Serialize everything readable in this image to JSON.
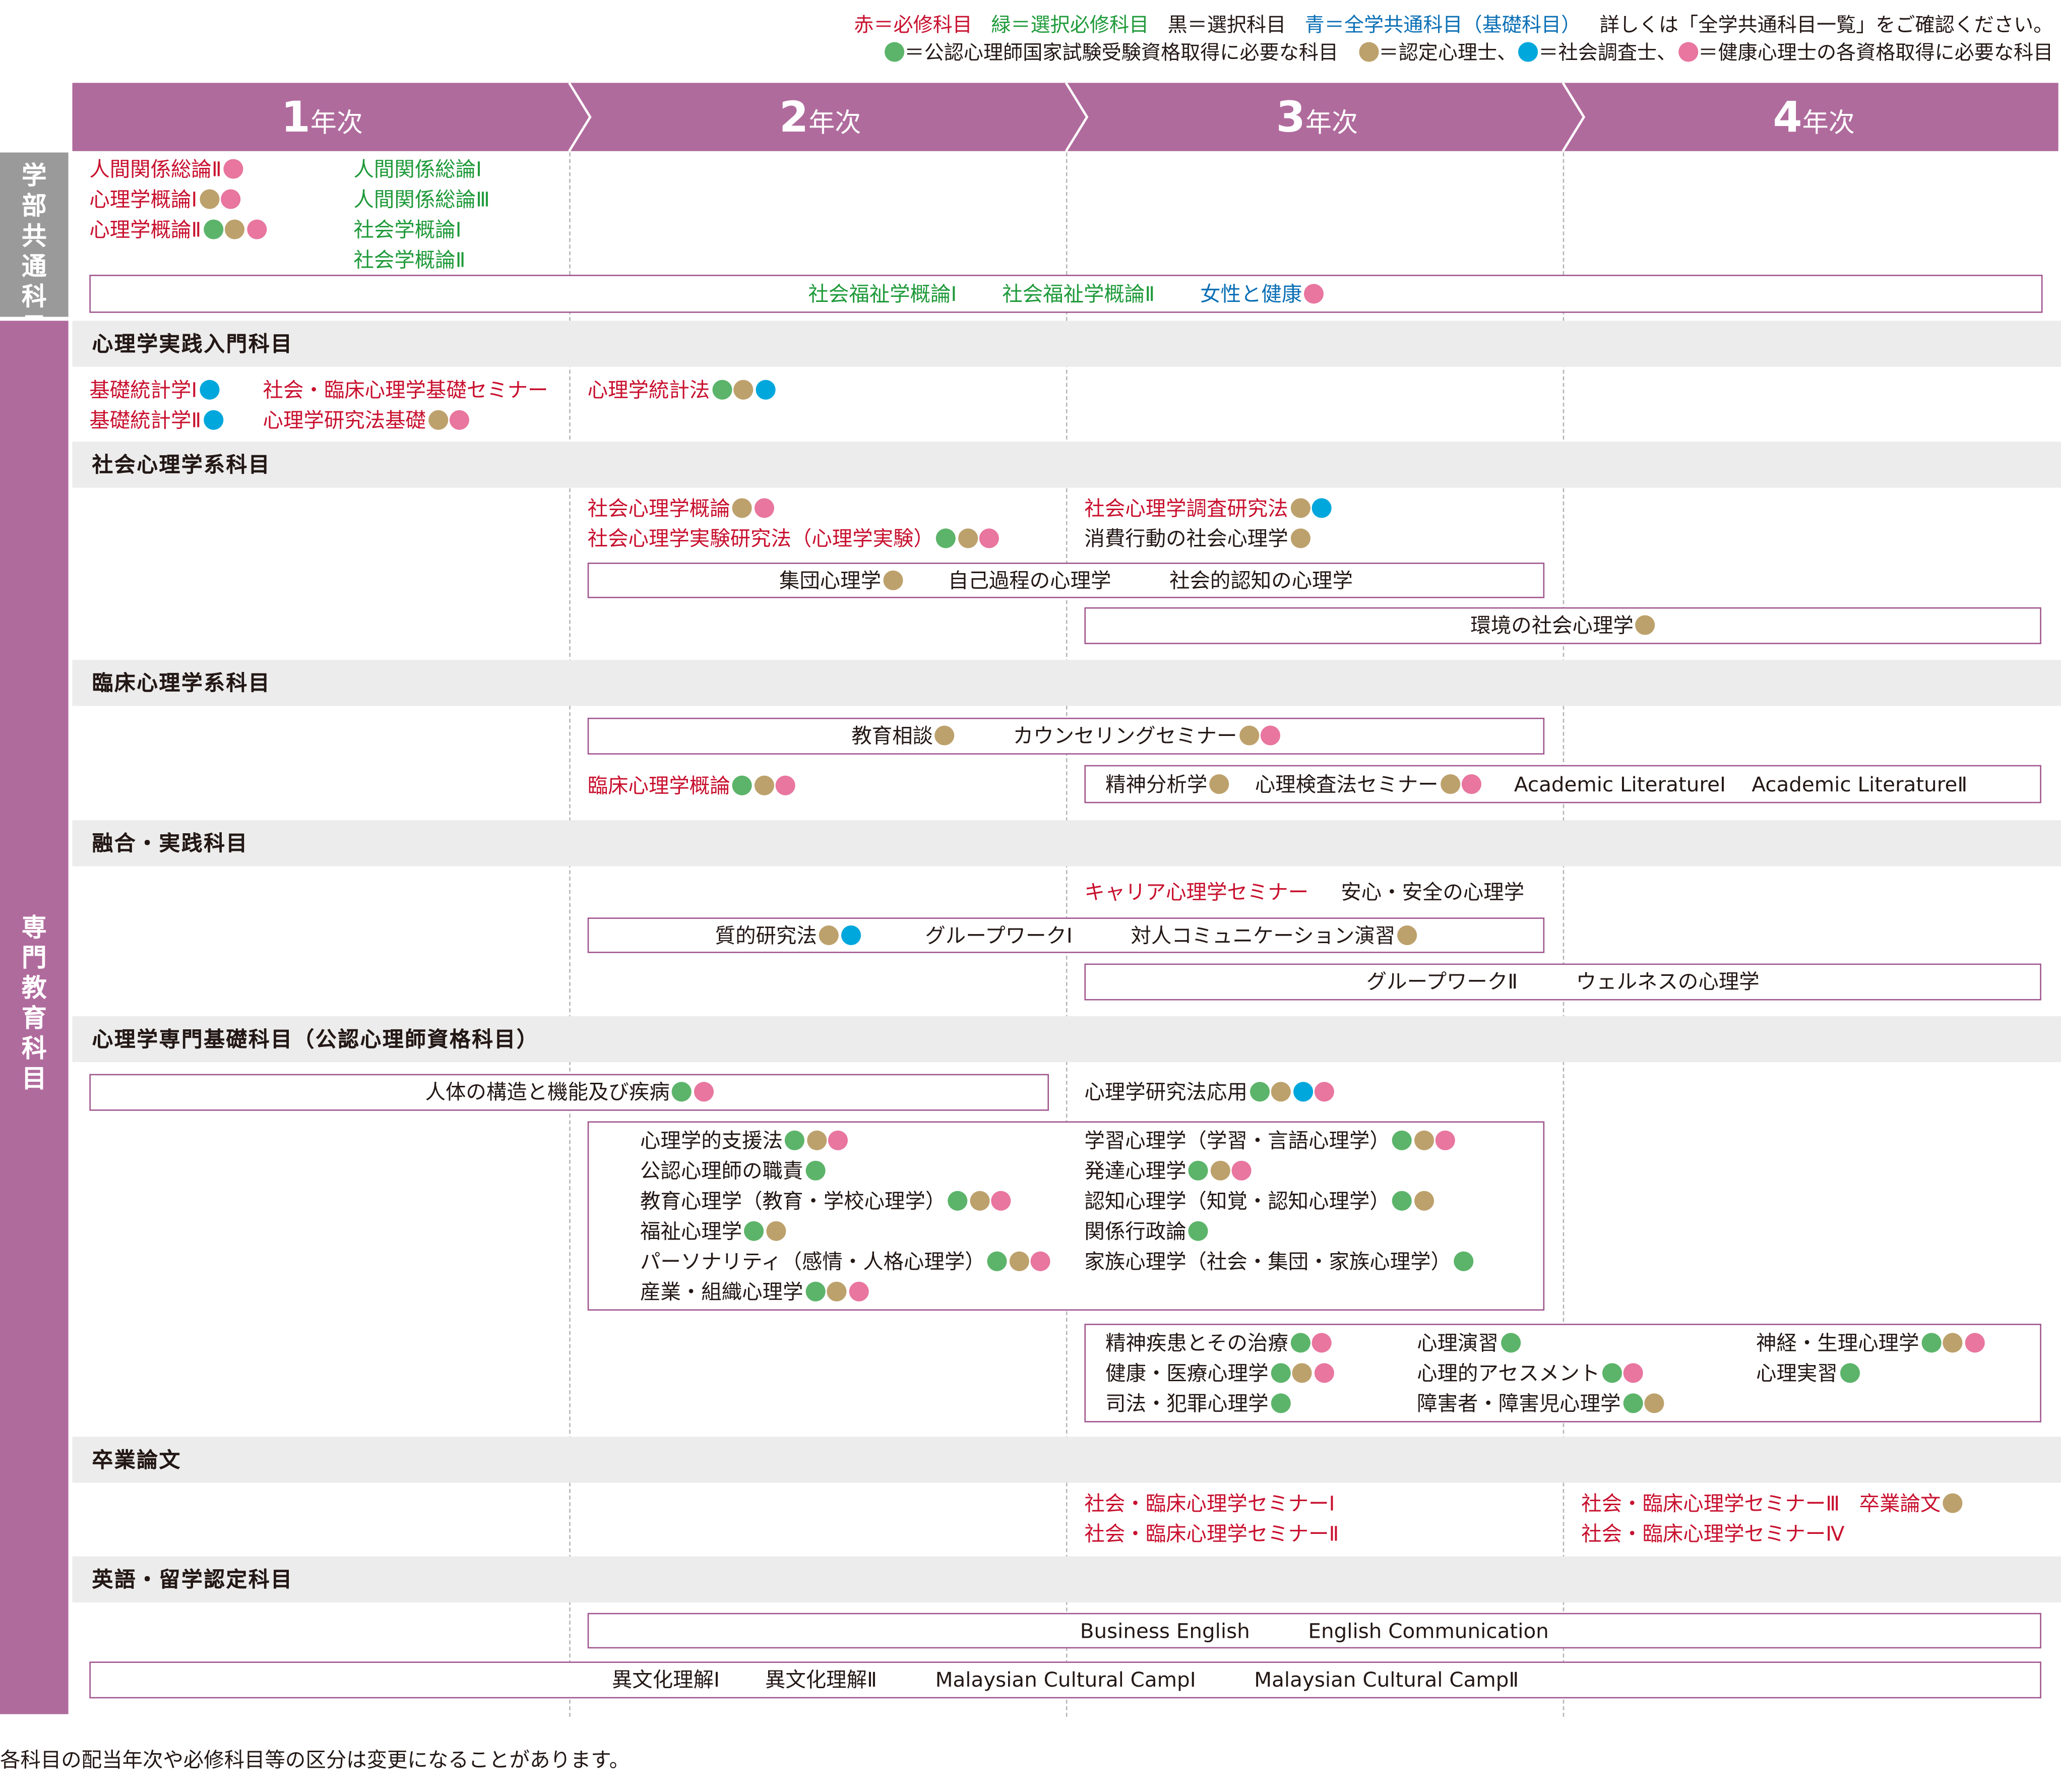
{
  "colors": {
    "purple": "#b06b9d",
    "red": "#c8102e",
    "green": "#1f9a3a",
    "blue": "#0a6fb5",
    "gray": "#9a9a9a",
    "dot_green": "#5cb46a",
    "dot_tan": "#bda16c",
    "dot_cyan": "#00a7dc",
    "dot_pink": "#e8769f"
  },
  "legend": {
    "red": "赤＝必修科目",
    "green": "緑＝選択必修科目",
    "black": "黒＝選択科目",
    "blue": "青＝全学共通科目（基礎科目）",
    "detail": "詳しくは「全学共通科目一覧」をご確認ください。",
    "dot_green": "＝公認心理師国家試験受験資格取得に必要な科目",
    "dot_tan": "＝認定心理士、",
    "dot_cyan": "＝社会調査士、",
    "dot_pink": "＝健康心理士の各資格取得に必要な科目"
  },
  "years": [
    {
      "num": "1",
      "label": "年次"
    },
    {
      "num": "2",
      "label": "年次"
    },
    {
      "num": "3",
      "label": "年次"
    },
    {
      "num": "4",
      "label": "年次"
    }
  ],
  "side": {
    "common": "学部共通科目",
    "specialized": "専門教育科目"
  },
  "sections": {
    "intro": "心理学実践入門科目",
    "social": "社会心理学系科目",
    "clinical": "臨床心理学系科目",
    "fusion": "融合・実践科目",
    "basic": "心理学専門基礎科目（公認心理師資格科目）",
    "thesis": "卒業論文",
    "english": "英語・留学認定科目"
  },
  "courses": {
    "c1": "人間関係総論Ⅱ",
    "c2": "心理学概論Ⅰ",
    "c3": "心理学概論Ⅱ",
    "c4": "人間関係総論Ⅰ",
    "c5": "人間関係総論Ⅲ",
    "c6": "社会学概論Ⅰ",
    "c7": "社会学概論Ⅱ",
    "c8": "社会福祉学概論Ⅰ",
    "c9": "社会福祉学概論Ⅱ",
    "c10": "女性と健康",
    "i1": "基礎統計学Ⅰ",
    "i2": "基礎統計学Ⅱ",
    "i3": "社会・臨床心理学基礎セミナー",
    "i4": "心理学研究法基礎",
    "i5": "心理学統計法",
    "s1": "社会心理学概論",
    "s2": "社会心理学実験研究法（心理学実験）",
    "s3": "社会心理学調査研究法",
    "s4": "消費行動の社会心理学",
    "s5": "集団心理学",
    "s6": "自己過程の心理学",
    "s7": "社会的認知の心理学",
    "s8": "環境の社会心理学",
    "k1": "教育相談",
    "k2": "カウンセリングセミナー",
    "k3": "臨床心理学概論",
    "k4": "精神分析学",
    "k5": "心理検査法セミナー",
    "k6": "Academic LiteratureⅠ",
    "k7": "Academic LiteratureⅡ",
    "f1": "キャリア心理学セミナー",
    "f2": "安心・安全の心理学",
    "f3": "質的研究法",
    "f4": "グループワークⅠ",
    "f5": "対人コミュニケーション演習",
    "f6": "グループワークⅡ",
    "f7": "ウェルネスの心理学",
    "b1": "人体の構造と機能及び疾病",
    "b2": "心理学研究法応用",
    "b3": "心理学的支援法",
    "b4": "公認心理師の職責",
    "b5": "教育心理学（教育・学校心理学）",
    "b6": "福祉心理学",
    "b7": "パーソナリティ（感情・人格心理学）",
    "b8": "産業・組織心理学",
    "b9": "学習心理学（学習・言語心理学）",
    "b10": "発達心理学",
    "b11": "認知心理学（知覚・認知心理学）",
    "b12": "関係行政論",
    "b13": "家族心理学（社会・集団・家族心理学）",
    "b14": "精神疾患とその治療",
    "b15": "健康・医療心理学",
    "b16": "司法・犯罪心理学",
    "b17": "心理演習",
    "b18": "心理的アセスメント",
    "b19": "障害者・障害児心理学",
    "b20": "神経・生理心理学",
    "b21": "心理実習",
    "t1": "社会・臨床心理学セミナーⅠ",
    "t2": "社会・臨床心理学セミナーⅡ",
    "t3": "社会・臨床心理学セミナーⅢ",
    "t4": "社会・臨床心理学セミナーⅣ",
    "t5": "卒業論文",
    "e1": "Business English",
    "e2": "English Communication",
    "e3": "異文化理解Ⅰ",
    "e4": "異文化理解Ⅱ",
    "e5": "Malaysian Cultural CampⅠ",
    "e6": "Malaysian Cultural CampⅡ"
  },
  "footnote": "各科目の配当年次や必修科目等の区分は変更になることがあります。"
}
